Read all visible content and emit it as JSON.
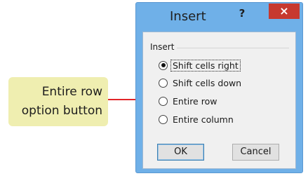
{
  "callout": {
    "line1": "Entire row",
    "line2": "option button"
  },
  "dialog": {
    "title": "Insert",
    "help_icon": "?",
    "close_icon": "×",
    "group_label": "Insert",
    "options": [
      {
        "label": "Shift cells right",
        "selected": true
      },
      {
        "label": "Shift cells down",
        "selected": false
      },
      {
        "label": "Entire row",
        "selected": false
      },
      {
        "label": "Entire column",
        "selected": false
      }
    ],
    "ok_label": "OK",
    "cancel_label": "Cancel"
  },
  "colors": {
    "frame": "#6fb0e8",
    "close": "#c7392f",
    "callout": "#efeeb0",
    "arrow": "#e2262a"
  }
}
